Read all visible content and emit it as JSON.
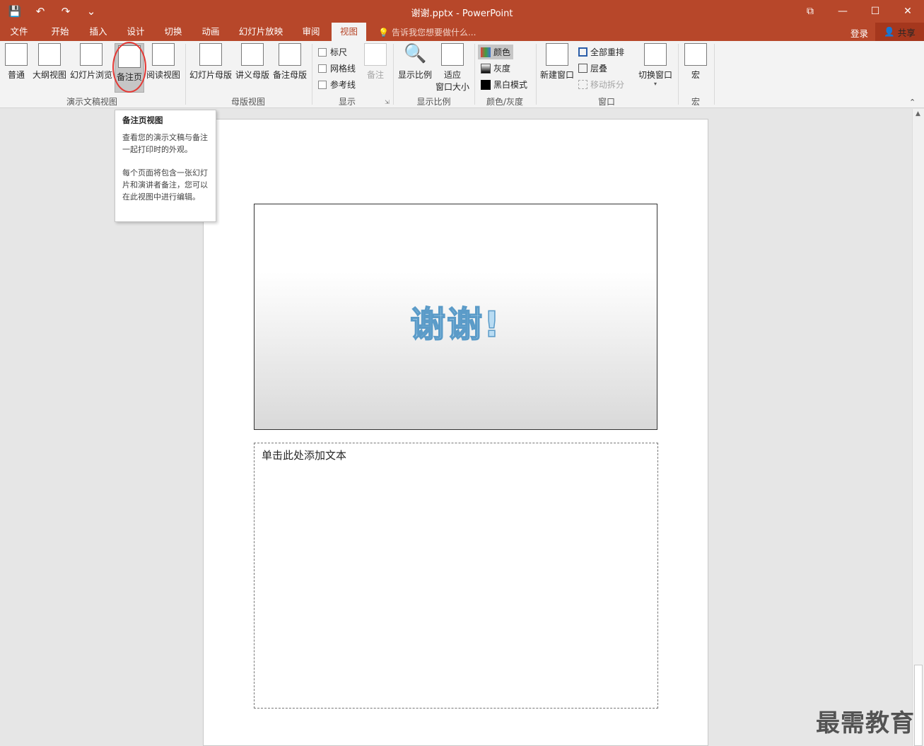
{
  "window": {
    "title": "谢谢.pptx - PowerPoint",
    "controls": [
      "⧉",
      "—",
      "☐",
      "✕"
    ]
  },
  "qat": {
    "save_icon": "💾",
    "undo_icon": "↶",
    "redo_icon": "↷",
    "customize_icon": "⌄"
  },
  "tabs": [
    {
      "label": "文件"
    },
    {
      "label": "开始"
    },
    {
      "label": "插入"
    },
    {
      "label": "设计"
    },
    {
      "label": "切换"
    },
    {
      "label": "动画"
    },
    {
      "label": "幻灯片放映"
    },
    {
      "label": "审阅"
    },
    {
      "label": "视图"
    }
  ],
  "tell_me": "告诉我您想要做什么...",
  "login": "登录",
  "share": "共享",
  "ribbon": {
    "views": {
      "label": "演示文稿视图",
      "buttons": [
        "普通",
        "大纲视图",
        "幻灯片浏览",
        "备注页",
        "阅读视图"
      ]
    },
    "master": {
      "label": "母版视图",
      "buttons": [
        "幻灯片母版",
        "讲义母版",
        "备注母版"
      ]
    },
    "show": {
      "label": "显示",
      "checks": [
        "标尺",
        "网格线",
        "参考线"
      ],
      "notes": "备注"
    },
    "zoom": {
      "label": "显示比例",
      "zoom": "显示比例",
      "fit1": "适应",
      "fit2": "窗口大小"
    },
    "color": {
      "label": "颜色/灰度",
      "items": [
        "颜色",
        "灰度",
        "黑白模式"
      ]
    },
    "window": {
      "label": "窗口",
      "new": "新建窗口",
      "arrange": "全部重排",
      "cascade": "层叠",
      "split": "移动拆分",
      "switch": "切换窗口"
    },
    "macro": {
      "label": "宏",
      "button": "宏"
    }
  },
  "tooltip": {
    "title": "备注页视图",
    "p1": "查看您的演示文稿与备注一起打印时的外观。",
    "p2": "每个页面将包含一张幻灯片和演讲者备注，您可以在此视图中进行编辑。"
  },
  "slide": {
    "title": "谢谢!"
  },
  "notes_placeholder": "单击此处添加文本",
  "watermark": "最需教育"
}
